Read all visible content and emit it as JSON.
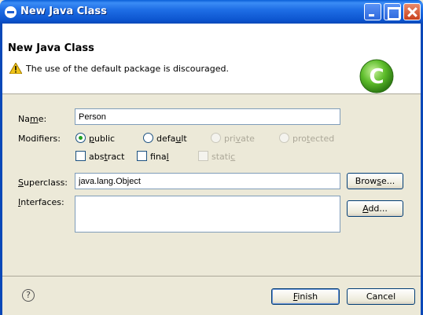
{
  "window": {
    "title": "New Java Class",
    "controls": [
      "minimize",
      "maximize",
      "close"
    ]
  },
  "banner": {
    "title": "New Java Class",
    "message": "The use of the default package is discouraged.",
    "message_icon": "warning-icon",
    "class_icon": "new-class-icon",
    "class_icon_letter": "C"
  },
  "form": {
    "name": {
      "label_pre": "Na",
      "label_mn": "m",
      "label_post": "e:",
      "value": "Person"
    },
    "modifiers": {
      "label": "Modifiers:",
      "options": [
        {
          "id": "public",
          "mn": "p",
          "rest": "ublic",
          "selected": true,
          "enabled": true
        },
        {
          "id": "default",
          "pre": "defa",
          "mn": "u",
          "rest": "lt",
          "selected": false,
          "enabled": true
        },
        {
          "id": "private",
          "pre": "pri",
          "mn": "v",
          "rest": "ate",
          "selected": false,
          "enabled": false
        },
        {
          "id": "protected",
          "pre": "pro",
          "mn": "t",
          "rest": "ected",
          "selected": false,
          "enabled": false
        }
      ],
      "checks": [
        {
          "id": "abstract",
          "pre": "abs",
          "mn": "t",
          "rest": "ract",
          "checked": false,
          "enabled": true
        },
        {
          "id": "final",
          "pre": "fina",
          "mn": "l",
          "rest": "",
          "checked": false,
          "enabled": true
        },
        {
          "id": "static",
          "pre": "stati",
          "mn": "c",
          "rest": "",
          "checked": false,
          "enabled": false
        }
      ]
    },
    "superclass": {
      "label_mn": "S",
      "label_rest": "uperclass:",
      "value": "java.lang.Object",
      "browse_pre": "Brow",
      "browse_mn": "s",
      "browse_rest": "e..."
    },
    "interfaces": {
      "label_mn": "I",
      "label_rest": "nterfaces:",
      "add_mn": "A",
      "add_rest": "dd..."
    }
  },
  "footer": {
    "help_icon": "help-icon",
    "help_glyph": "?",
    "finish_mn": "F",
    "finish_rest": "inish",
    "cancel": "Cancel"
  }
}
